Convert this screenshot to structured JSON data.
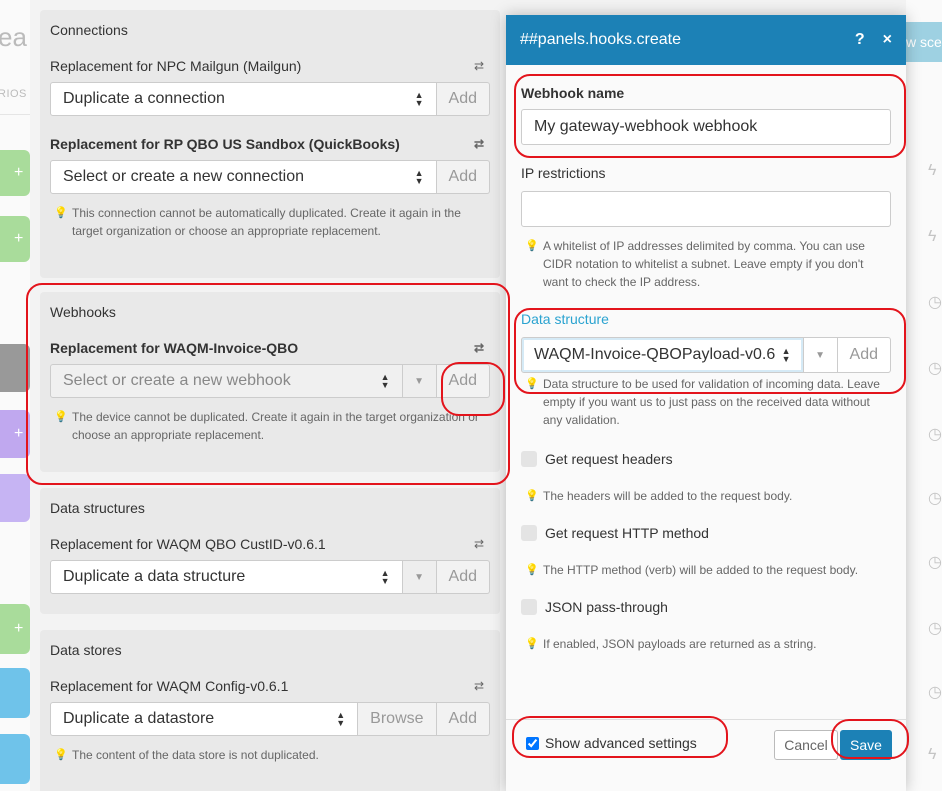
{
  "background": {
    "left_title_partial": "ea",
    "left_subtitle_partial": "RIOS",
    "right_button_partial": "w sce"
  },
  "connections": {
    "title": "Connections",
    "items": [
      {
        "label": "Replacement for NPC Mailgun (Mailgun)",
        "value": "Duplicate a connection",
        "add": "Add"
      },
      {
        "label": "Replacement for RP QBO US Sandbox (QuickBooks)",
        "value": "Select or create a new connection",
        "add": "Add",
        "hint": "This connection cannot be automatically duplicated. Create it again in the target organization or choose an appropriate replacement."
      }
    ]
  },
  "webhooks": {
    "title": "Webhooks",
    "label": "Replacement for WAQM-Invoice-QBO",
    "value": "Select or create a new webhook",
    "add": "Add",
    "hint": "The device cannot be duplicated. Create it again in the target organization or choose an appropriate replacement."
  },
  "data_structures": {
    "title": "Data structures",
    "label": "Replacement for WAQM QBO CustID-v0.6.1",
    "value": "Duplicate a data structure",
    "add": "Add"
  },
  "data_stores": {
    "title": "Data stores",
    "label": "Replacement for WAQM Config-v0.6.1",
    "value": "Duplicate a datastore",
    "browse": "Browse",
    "add": "Add",
    "hint": "The content of the data store is not duplicated."
  },
  "modal": {
    "title": "##panels.hooks.create",
    "help": "?",
    "close": "×",
    "webhook_name": {
      "label": "Webhook name",
      "value": "My gateway-webhook webhook"
    },
    "ip_restrictions": {
      "label": "IP restrictions",
      "value": "",
      "hint": "A whitelist of IP addresses delimited by comma. You can use CIDR notation to whitelist a subnet. Leave empty if you don't want to check the IP address."
    },
    "data_structure": {
      "label": "Data structure",
      "value": "WAQM-Invoice-QBOPayload-v0.6",
      "add": "Add",
      "hint": "Data structure to be used for validation of incoming data. Leave empty if you want us to just pass on the received data without any validation."
    },
    "options": [
      {
        "label": "Get request headers",
        "hint": "The headers will be added to the request body."
      },
      {
        "label": "Get request HTTP method",
        "hint": "The HTTP method (verb) will be added to the request body."
      },
      {
        "label": "JSON pass-through",
        "hint": "If enabled, JSON payloads are returned as a string."
      }
    ],
    "advanced": {
      "label": "Show advanced settings",
      "checked": true
    },
    "cancel": "Cancel",
    "save": "Save"
  },
  "colors": {
    "header": "#1c81b6",
    "accent": "#2aa3d0",
    "save": "#1c81b6",
    "annotation": "#e3141c"
  }
}
